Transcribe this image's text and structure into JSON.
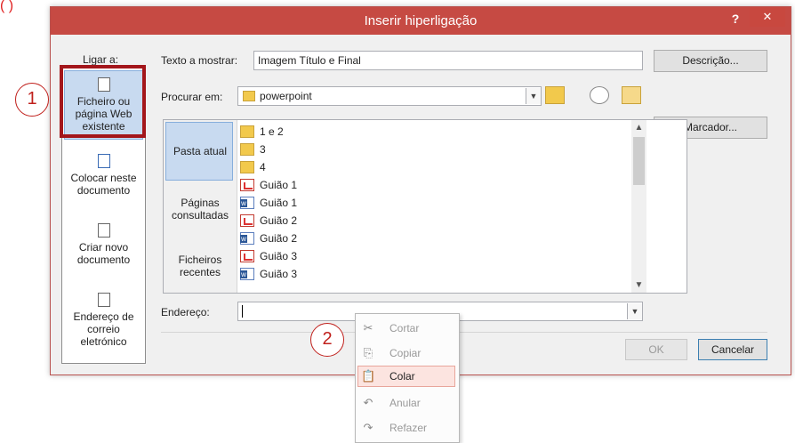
{
  "corner_mark": "( )",
  "dialog": {
    "title": "Inserir hiperligação",
    "help_label": "?",
    "close_label": "✕"
  },
  "link_to": {
    "heading": "Ligar a:",
    "items": [
      {
        "label_lines": [
          "Ficheiro ou",
          "página Web",
          "existente"
        ],
        "selected": true
      },
      {
        "label_lines": [
          "Colocar neste",
          "documento"
        ],
        "selected": false
      },
      {
        "label_lines": [
          "Criar novo",
          "documento"
        ],
        "selected": false
      },
      {
        "label_lines": [
          "Endereço de",
          "correio",
          "eletrónico"
        ],
        "selected": false
      }
    ]
  },
  "text_to_display": {
    "label": "Texto a mostrar:",
    "value": "Imagem Título e Final"
  },
  "buttons": {
    "description": "Descrição...",
    "bookmark": "Marcador...",
    "ok": "OK",
    "cancel": "Cancelar"
  },
  "look_in": {
    "label": "Procurar em:",
    "value": "powerpoint"
  },
  "side_tabs": [
    {
      "label_lines": [
        "Pasta atual"
      ],
      "selected": true
    },
    {
      "label_lines": [
        "Páginas",
        "consultadas"
      ],
      "selected": false
    },
    {
      "label_lines": [
        "Ficheiros",
        "recentes"
      ],
      "selected": false
    }
  ],
  "files": [
    {
      "name": "1 e 2",
      "type": "folder"
    },
    {
      "name": "3",
      "type": "folder"
    },
    {
      "name": "4",
      "type": "folder"
    },
    {
      "name": "Guião 1",
      "type": "pdf"
    },
    {
      "name": "Guião 1",
      "type": "word"
    },
    {
      "name": "Guião 2",
      "type": "pdf"
    },
    {
      "name": "Guião 2",
      "type": "word"
    },
    {
      "name": "Guião 3",
      "type": "pdf"
    },
    {
      "name": "Guião 3",
      "type": "word"
    }
  ],
  "address": {
    "label": "Endereço:",
    "value": ""
  },
  "context_menu": {
    "items": [
      {
        "label": "Cortar",
        "icon": "✂",
        "enabled": false
      },
      {
        "label": "Copiar",
        "icon": "⎘",
        "enabled": false
      },
      {
        "label": "Colar",
        "icon": "📋",
        "enabled": true
      },
      {
        "label": "Anular",
        "icon": "↶",
        "enabled": false
      },
      {
        "label": "Refazer",
        "icon": "↷",
        "enabled": false
      }
    ]
  },
  "callouts": {
    "one": "1",
    "two": "2"
  },
  "colors": {
    "titlebar": "#c64a43",
    "selection": "#c8daf0",
    "highlight_border": "#a3161b",
    "callout": "#c0201c"
  }
}
